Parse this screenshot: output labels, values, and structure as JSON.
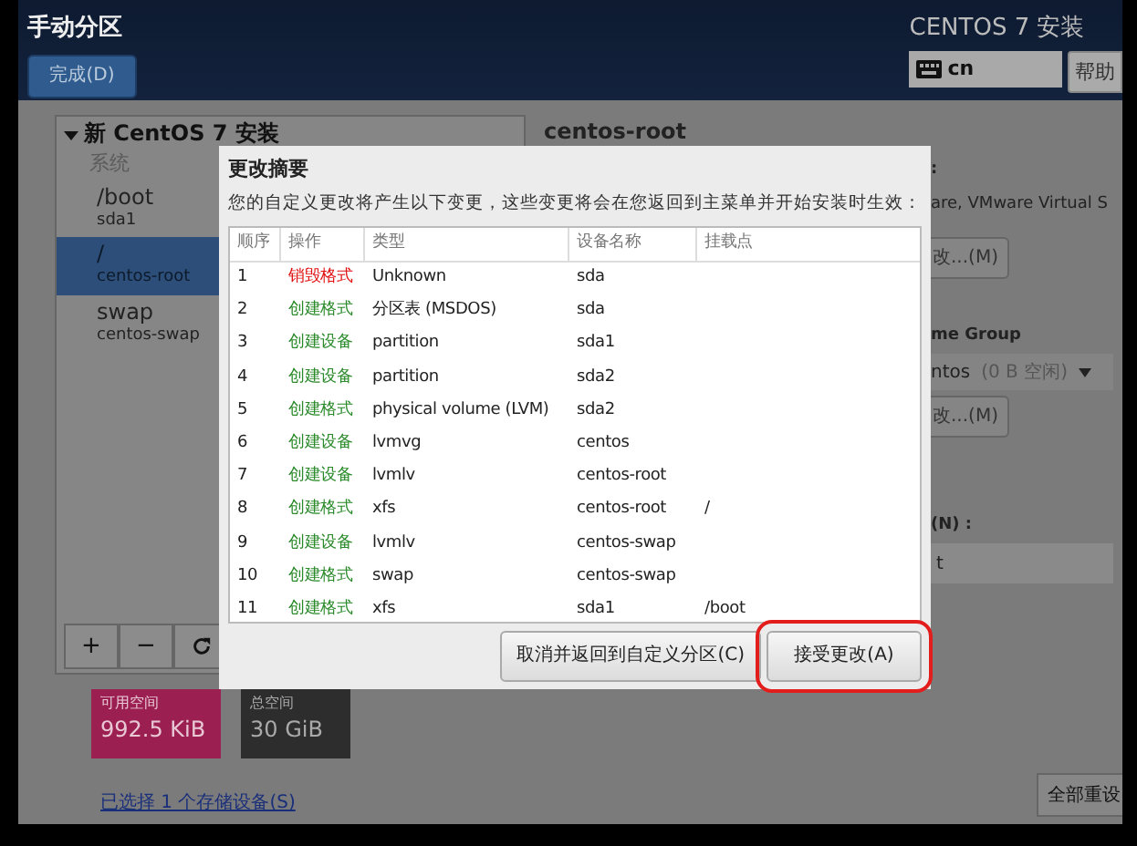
{
  "header": {
    "title": "手动分区",
    "done_button": "完成(D)",
    "product": "CENTOS 7 安装",
    "keyboard_layout": "cn",
    "help_button": "帮助"
  },
  "left_panel": {
    "group_label": "新 CentOS 7 安装",
    "section_label": "系统",
    "items": [
      {
        "mount": "/boot",
        "device": "sda1",
        "selected": false
      },
      {
        "mount": "/",
        "device": "centos-root",
        "selected": true
      },
      {
        "mount": "swap",
        "device": "centos-swap",
        "selected": false
      }
    ],
    "toolbar": [
      {
        "kind": "text",
        "label": "+"
      },
      {
        "kind": "text",
        "label": "−"
      },
      {
        "kind": "refresh"
      }
    ]
  },
  "space": {
    "available_label": "可用空间",
    "available_value": "992.5 KiB",
    "total_label": "总空间",
    "total_value": "30 GiB"
  },
  "storage_link": "已选择 1 个存储设备(S)",
  "right_panel": {
    "title": "centos-root",
    "colon": ":",
    "device_text": "are, VMware Virtual S",
    "modify_button": "改...(M)",
    "vg_label": "me Group",
    "vg_value": "ntos",
    "vg_free": "(0 B 空闲)",
    "vg_modify_button": "改...(M)",
    "name_label": "(N) :",
    "name_value": "t",
    "reset_button": "全部重设"
  },
  "dialog": {
    "title": "更改摘要",
    "message": "您的自定义更改将产生以下变更，这些变更将会在您返回到主菜单并开始安装时生效：",
    "columns": [
      "顺序",
      "操作",
      "类型",
      "设备名称",
      "挂载点"
    ],
    "rows": [
      {
        "order": "1",
        "action": "销毁格式",
        "kind": "destroy",
        "type": "Unknown",
        "device": "sda",
        "mount": ""
      },
      {
        "order": "2",
        "action": "创建格式",
        "kind": "create",
        "type": "分区表 (MSDOS)",
        "device": "sda",
        "mount": ""
      },
      {
        "order": "3",
        "action": "创建设备",
        "kind": "create",
        "type": "partition",
        "device": "sda1",
        "mount": ""
      },
      {
        "order": "4",
        "action": "创建设备",
        "kind": "create",
        "type": "partition",
        "device": "sda2",
        "mount": ""
      },
      {
        "order": "5",
        "action": "创建格式",
        "kind": "create",
        "type": "physical volume (LVM)",
        "device": "sda2",
        "mount": ""
      },
      {
        "order": "6",
        "action": "创建设备",
        "kind": "create",
        "type": "lvmvg",
        "device": "centos",
        "mount": ""
      },
      {
        "order": "7",
        "action": "创建设备",
        "kind": "create",
        "type": "lvmlv",
        "device": "centos-root",
        "mount": ""
      },
      {
        "order": "8",
        "action": "创建格式",
        "kind": "create",
        "type": "xfs",
        "device": "centos-root",
        "mount": "/"
      },
      {
        "order": "9",
        "action": "创建设备",
        "kind": "create",
        "type": "lvmlv",
        "device": "centos-swap",
        "mount": ""
      },
      {
        "order": "10",
        "action": "创建格式",
        "kind": "create",
        "type": "swap",
        "device": "centos-swap",
        "mount": ""
      },
      {
        "order": "11",
        "action": "创建格式",
        "kind": "create",
        "type": "xfs",
        "device": "sda1",
        "mount": "/boot"
      }
    ],
    "buttons": [
      {
        "label": "取消并返回到自定义分区(C)",
        "highlighted": false
      },
      {
        "label": "接受更改(A)",
        "highlighted": true
      }
    ]
  }
}
